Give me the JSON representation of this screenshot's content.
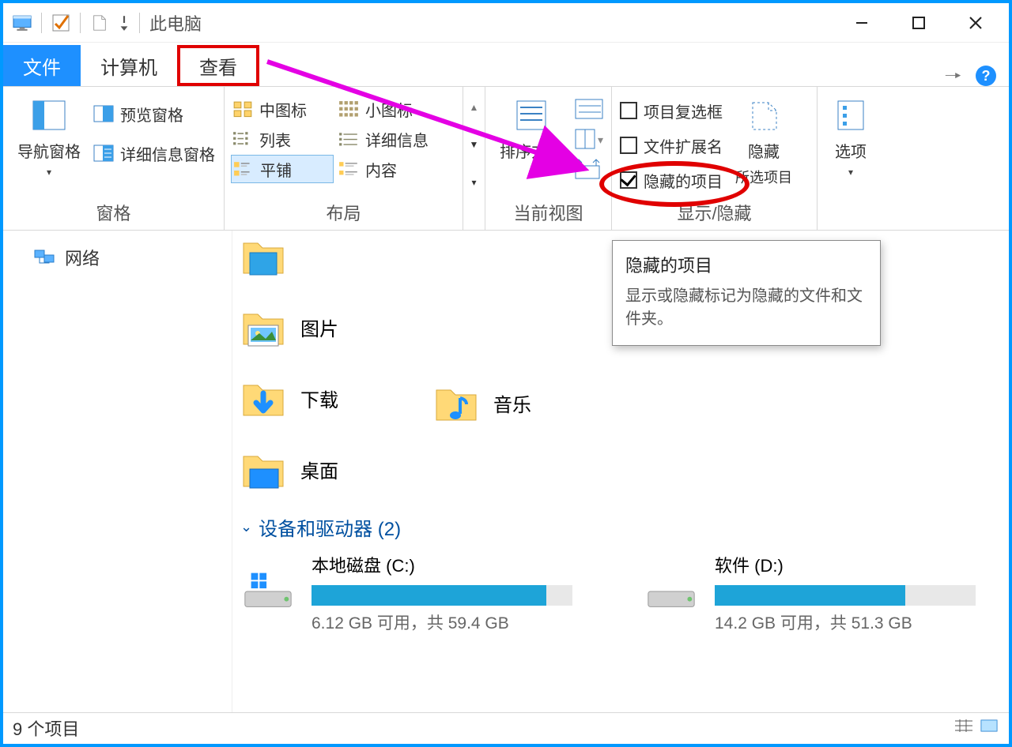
{
  "window": {
    "title": "此电脑"
  },
  "tabs": {
    "file": "文件",
    "computer": "计算机",
    "view": "查看"
  },
  "ribbon": {
    "panes": {
      "label": "窗格",
      "nav": "导航窗格",
      "preview": "预览窗格",
      "details": "详细信息窗格"
    },
    "layout": {
      "label": "布局",
      "medium_icons": "中图标",
      "small_icons": "小图标",
      "list": "列表",
      "details": "详细信息",
      "tiles": "平铺",
      "content": "内容"
    },
    "current_view": {
      "label": "当前视图",
      "sort_by": "排序方式"
    },
    "show_hide": {
      "label": "显示/隐藏",
      "item_checkboxes": "项目复选框",
      "file_extensions": "文件扩展名",
      "hidden_items": "隐藏的项目",
      "hide": "隐藏",
      "hide_selected": "所选项目"
    },
    "options": {
      "label": "选项"
    }
  },
  "sidebar": {
    "network": "网络"
  },
  "content": {
    "folders": {
      "pictures": "图片",
      "downloads": "下载",
      "desktop": "桌面",
      "music": "音乐"
    },
    "group_devices": "设备和驱动器 (2)",
    "drives": [
      {
        "name": "本地磁盘 (C:)",
        "detail": "6.12 GB 可用，共 59.4 GB",
        "fill": 90
      },
      {
        "name": "软件 (D:)",
        "detail": "14.2 GB 可用，共 51.3 GB",
        "fill": 73
      }
    ]
  },
  "tooltip": {
    "title": "隐藏的项目",
    "body": "显示或隐藏标记为隐藏的文件和文件夹。"
  },
  "statusbar": {
    "items": "9 个项目"
  }
}
